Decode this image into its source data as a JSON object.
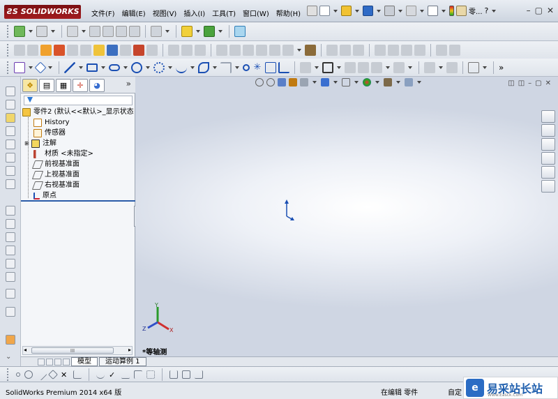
{
  "app": {
    "logo_text": "SOLIDWORKS",
    "brand_color": "#8b1518",
    "accent_color": "#2a5ba8"
  },
  "menu": {
    "items": [
      "文件(F)",
      "编辑(E)",
      "视图(V)",
      "插入(I)",
      "工具(T)",
      "窗口(W)",
      "帮助(H)"
    ],
    "help_search_text": "零...",
    "help_q": "?"
  },
  "feature_manager": {
    "tabs_more": "»",
    "tree": [
      {
        "label": "零件2 (默认<<默认>_显示状态",
        "icon": "part-icon"
      },
      {
        "label": "History",
        "icon": "history-icon"
      },
      {
        "label": "传感器",
        "icon": "sensor-icon"
      },
      {
        "label": "注解",
        "icon": "annotation-icon"
      },
      {
        "label": "材质 <未指定>",
        "icon": "material-icon"
      },
      {
        "label": "前视基准面",
        "icon": "plane-icon"
      },
      {
        "label": "上视基准面",
        "icon": "plane-icon"
      },
      {
        "label": "右视基准面",
        "icon": "plane-icon"
      },
      {
        "label": "原点",
        "icon": "origin-icon"
      }
    ],
    "scroll_thumb": "III"
  },
  "graphics": {
    "view_label": "*等轴测",
    "triad": {
      "x": "X",
      "y": "Y",
      "z": "Z"
    }
  },
  "bottom_tabs": [
    "模型",
    "运动算例 1"
  ],
  "sketch_more": "»",
  "status": {
    "left": "SolidWorks Premium 2014 x64 版",
    "mode": "在编辑 零件",
    "custom": "自定"
  },
  "watermark": {
    "text": "易采站长站",
    "sub": "Www.Easck.Com"
  }
}
